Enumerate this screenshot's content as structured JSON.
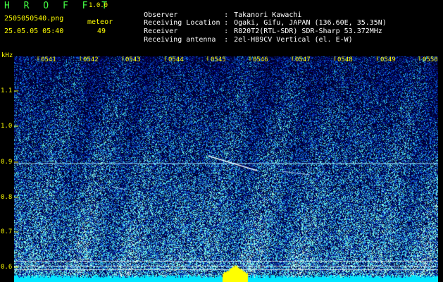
{
  "header": {
    "app_title": "H R O F F T",
    "app_version": "1.0.0",
    "filename": "2505050540.png",
    "mode_label": "meteor",
    "datetime": "25.05.05 05:40",
    "meteor_count": "49"
  },
  "info": [
    {
      "label": "Observer",
      "value": "Takanori Kawachi"
    },
    {
      "label": "Receiving Location",
      "value": "Ogaki, Gifu, JAPAN (136.60E, 35.35N)"
    },
    {
      "label": "Receiver",
      "value": "R820T2(RTL-SDR) SDR-Sharp 53.372MHz"
    },
    {
      "label": "Receiving antenna",
      "value": "2el-HB9CV Vertical (el. E-W)"
    }
  ],
  "separator": ":",
  "axis": {
    "y_unit": "kHz",
    "y_ticks": [
      "1.1",
      "1.0",
      "0.9",
      "0.8",
      "0.7",
      "0.6"
    ],
    "x_ticks": [
      "0541",
      "0542",
      "0543",
      "0544",
      "0545",
      "0546",
      "0547",
      "0548",
      "0549",
      "0550"
    ]
  },
  "colors": {
    "background": "#000000",
    "spectrogram_base": "#00001e",
    "spectrogram_mid": "#1a3cdc",
    "spectrogram_hot": "#33ffee",
    "tick_text": "#ffff00",
    "title_text": "#44ff44",
    "info_text": "#ffffff",
    "reference_line": "#9fe6ff",
    "bottom_bar": "#00e5ff",
    "bottom_peak": "#ffff00"
  }
}
